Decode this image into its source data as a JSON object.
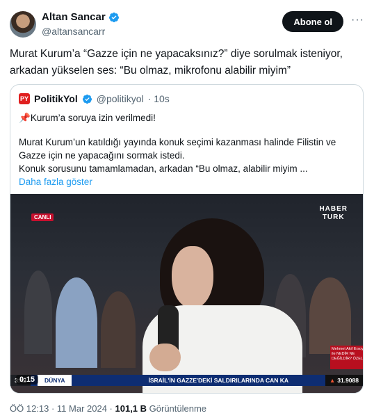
{
  "author": {
    "display_name": "Altan Sancar",
    "handle": "@altansancarr"
  },
  "actions": {
    "follow_label": "Abone ol",
    "more_label": "···"
  },
  "tweet": {
    "text": "Murat Kurum’a “Gazze için ne yapacaksınız?” diye sorulmak isteniyor, arkadan yükselen ses: “Bu olmaz, mikrofonu alabilir miyim”"
  },
  "quote": {
    "logo_text": "PY",
    "name": "PolitikYol",
    "handle": "@politikyol",
    "time": "· 10s",
    "headline": "Kurum’a soruya izin verilmedi!",
    "pin_emoji": "📌",
    "paragraph1": "Murat Kurum’un katıldığı yayında konuk seçimi kazanması halinde Filistin ve Gazze için ne yapacağını sormak istedi.",
    "paragraph2": "Konuk sorusunu tamamlamadan, arkadan “Bu olmaz, alabilir miyim ...",
    "show_more": "Daha fazla göster"
  },
  "video": {
    "live_badge": "CANLI",
    "brand_line1": "HABER",
    "brand_line2": "TURK",
    "lower_third": "Mehmet Akif Ersoy ile NEDİR NE DEĞİLDİR? ÖZEL",
    "ticker_time": "3:42",
    "ticker_label": "DÜNYA",
    "ticker_news": "İSRAİL'İN GAZZE'DEKİ SALDIRILARINDA CAN KA",
    "ticker_stock": "31.9088",
    "ticker_stock_arrow": "▲",
    "duration": "0:15"
  },
  "footer": {
    "time_date": "ÖÖ 12:13 · 11 Mar 2024 · ",
    "views_count": "101,1 B",
    "views_label": " Görüntülenme"
  }
}
